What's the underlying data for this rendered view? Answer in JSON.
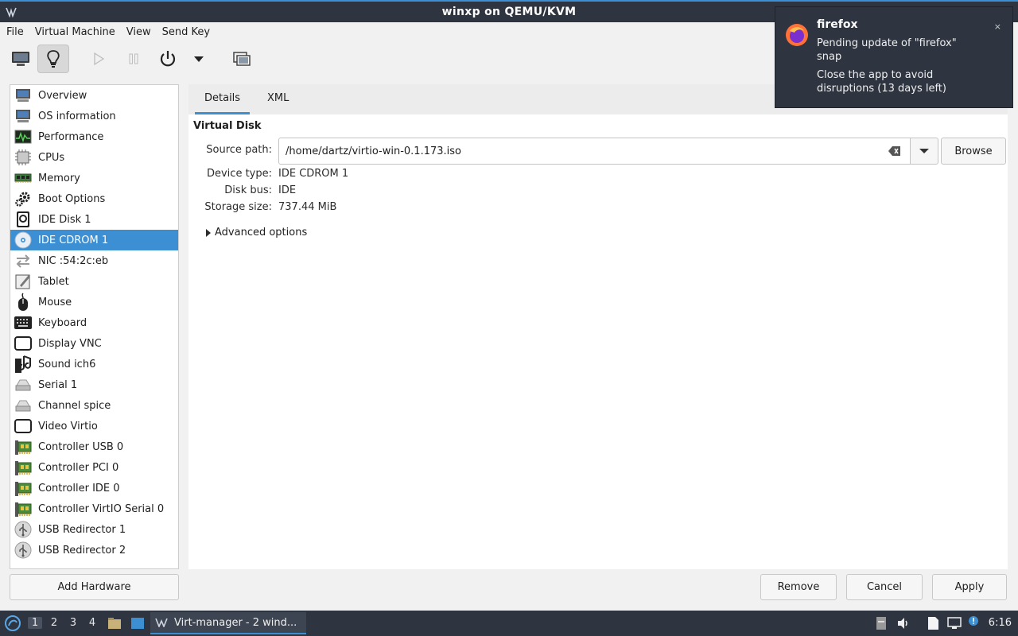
{
  "window": {
    "title": "winxp on QEMU/KVM"
  },
  "menu": [
    "File",
    "Virtual Machine",
    "View",
    "Send Key"
  ],
  "sidebar": {
    "items": [
      {
        "label": "Overview",
        "icon": "monitor-icon"
      },
      {
        "label": "OS information",
        "icon": "monitor-icon"
      },
      {
        "label": "Performance",
        "icon": "performance-graph-icon"
      },
      {
        "label": "CPUs",
        "icon": "cpu-chip-icon"
      },
      {
        "label": "Memory",
        "icon": "memory-module-icon"
      },
      {
        "label": "Boot Options",
        "icon": "gear-icon"
      },
      {
        "label": "IDE Disk 1",
        "icon": "hard-disk-icon"
      },
      {
        "label": "IDE CDROM 1",
        "icon": "cdrom-disc-icon"
      },
      {
        "label": "NIC :54:2c:eb",
        "icon": "network-arrows-icon"
      },
      {
        "label": "Tablet",
        "icon": "tablet-pen-icon"
      },
      {
        "label": "Mouse",
        "icon": "mouse-icon"
      },
      {
        "label": "Keyboard",
        "icon": "keyboard-icon"
      },
      {
        "label": "Display VNC",
        "icon": "display-icon"
      },
      {
        "label": "Sound ich6",
        "icon": "sound-card-icon"
      },
      {
        "label": "Serial 1",
        "icon": "serial-port-icon"
      },
      {
        "label": "Channel spice",
        "icon": "serial-port-icon"
      },
      {
        "label": "Video Virtio",
        "icon": "display-icon"
      },
      {
        "label": "Controller USB 0",
        "icon": "controller-card-icon"
      },
      {
        "label": "Controller PCI 0",
        "icon": "controller-card-icon"
      },
      {
        "label": "Controller IDE 0",
        "icon": "controller-card-icon"
      },
      {
        "label": "Controller VirtIO Serial 0",
        "icon": "controller-card-icon"
      },
      {
        "label": "USB Redirector 1",
        "icon": "usb-icon"
      },
      {
        "label": "USB Redirector 2",
        "icon": "usb-icon"
      }
    ],
    "selected": "IDE CDROM 1",
    "add_hardware": "Add Hardware"
  },
  "tabs": [
    "Details",
    "XML"
  ],
  "details": {
    "section_title": "Virtual Disk",
    "source_path_label": "Source path:",
    "source_path_value": "/home/dartz/virtio-win-0.1.173.iso",
    "browse": "Browse",
    "device_type_label": "Device type:",
    "device_type_value": "IDE CDROM 1",
    "disk_bus_label": "Disk bus:",
    "disk_bus_value": "IDE",
    "storage_size_label": "Storage size:",
    "storage_size_value": "737.44 MiB",
    "advanced": "Advanced options"
  },
  "buttons": {
    "remove": "Remove",
    "cancel": "Cancel",
    "apply": "Apply"
  },
  "notification": {
    "app": "firefox",
    "line1": "Pending update of \"firefox\"",
    "line2": "snap",
    "line3": "Close the app to avoid",
    "line4": "disruptions (13 days left)",
    "close": "×"
  },
  "taskbar": {
    "workspaces": [
      "1",
      "2",
      "3",
      "4"
    ],
    "task_label": "Virt-manager - 2 wind...",
    "clock": "6:16"
  },
  "colors": {
    "accent": "#3d8fd4",
    "panel_dark": "#2e3440"
  }
}
